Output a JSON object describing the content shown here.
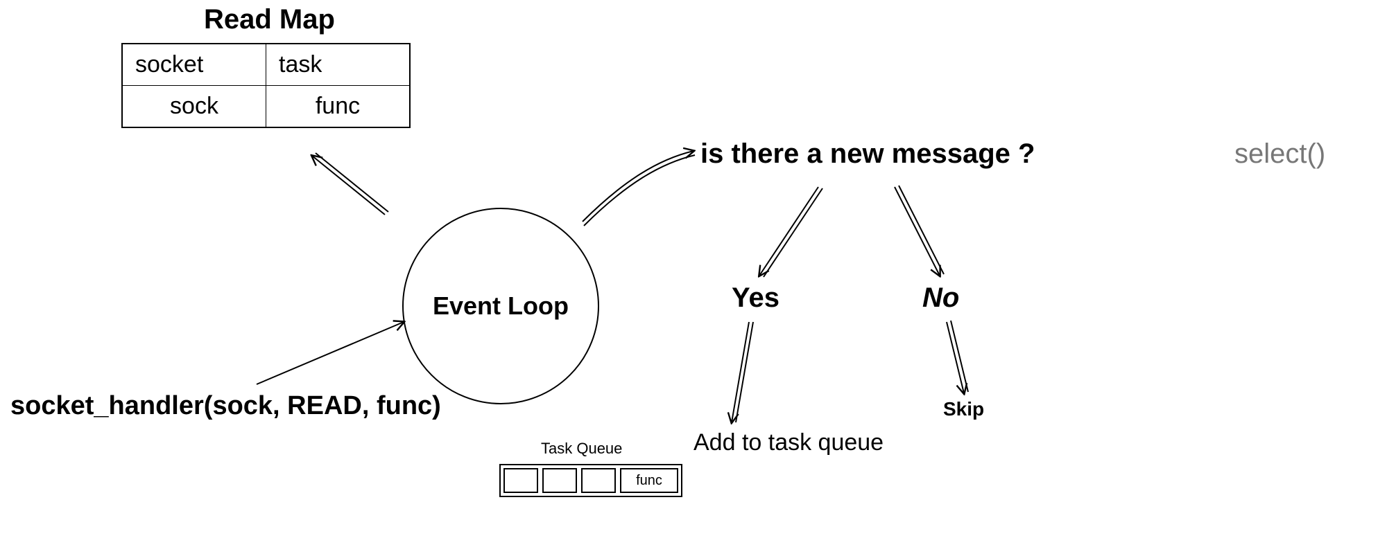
{
  "read_map": {
    "title": "Read Map",
    "headers": [
      "socket",
      "task"
    ],
    "row": [
      "sock",
      "func"
    ]
  },
  "event_loop": {
    "label": "Event Loop"
  },
  "handler_call": "socket_handler(sock, READ, func)",
  "question": {
    "text": "is there a new message ?",
    "syscall": "select()"
  },
  "branches": {
    "yes": "Yes",
    "no": "No",
    "yes_action": "Add to task queue",
    "no_action": "Skip"
  },
  "task_queue": {
    "title": "Task Queue",
    "func_label": "func"
  }
}
